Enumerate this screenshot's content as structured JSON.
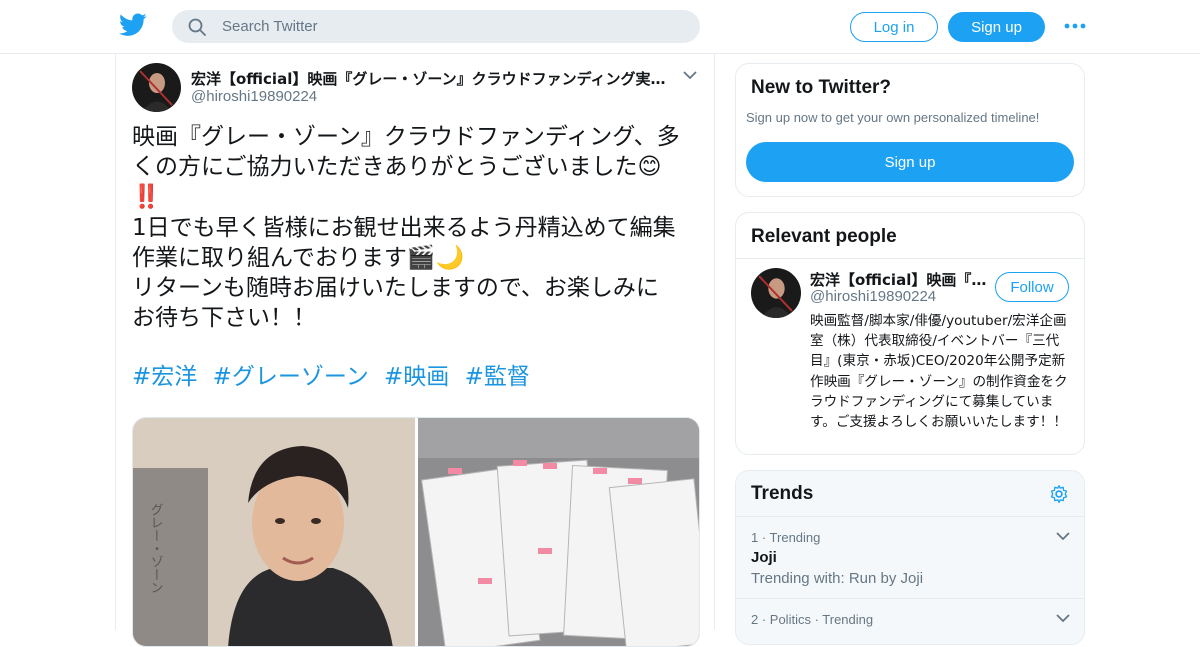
{
  "header": {
    "search_placeholder": "Search Twitter",
    "login_label": "Log in",
    "signup_label": "Sign up"
  },
  "tweet": {
    "author_name": "宏洋【official】映画『グレー・ゾーン』クラウドファンディング実施中",
    "author_handle": "@hiroshi19890224",
    "text_lines": [
      "映画『グレー・ゾーン』クラウドファンディング、多",
      "くの方にご協力いただきありがとうございました😊",
      "‼️",
      "1日でも早く皆様にお観せ出来るよう丹精込めて編集",
      "作業に取り組んでおります🎬🌙",
      "リターンも随時お届けいたしますので、お楽しみに",
      "お待ち下さい！！"
    ],
    "hashtags": [
      "#宏洋",
      "#グレーゾーン",
      "#映画",
      "#監督"
    ],
    "media": {
      "left_description": "portrait",
      "book_vertical_text": "グレー・ゾーン"
    }
  },
  "sidebar": {
    "new_to_twitter": {
      "title": "New to Twitter?",
      "subtitle": "Sign up now to get your own personalized timeline!",
      "button": "Sign up"
    },
    "relevant_people": {
      "title": "Relevant people",
      "person": {
        "name": "宏洋【official】映画『グレー・ゾーン』",
        "handle": "@hiroshi19890224",
        "follow_label": "Follow",
        "bio": "映画監督/脚本家/俳優/youtuber/宏洋企画室（株）代表取締役/イベントバー『三代目』(東京・赤坂)CEO/2020年公開予定新作映画『グレー・ゾーン』の制作資金をクラウドファンディングにて募集しています。ご支援よろしくお願いいたします！！"
      }
    },
    "trends": {
      "title": "Trends",
      "items": [
        {
          "meta": "1 · Trending",
          "name": "Joji",
          "context": "Trending with: Run by Joji"
        },
        {
          "meta": "2 · Politics · Trending",
          "name": "",
          "context": ""
        }
      ]
    }
  },
  "colors": {
    "accent": "#1da1f2",
    "hashtag": "#1b95e0",
    "muted": "#657786",
    "border": "#e6ecf0"
  },
  "icons": {
    "logo": "twitter-bird-icon",
    "search": "search-icon",
    "more": "more-dots-icon",
    "caret": "chevron-down-icon",
    "gear": "gear-icon"
  }
}
